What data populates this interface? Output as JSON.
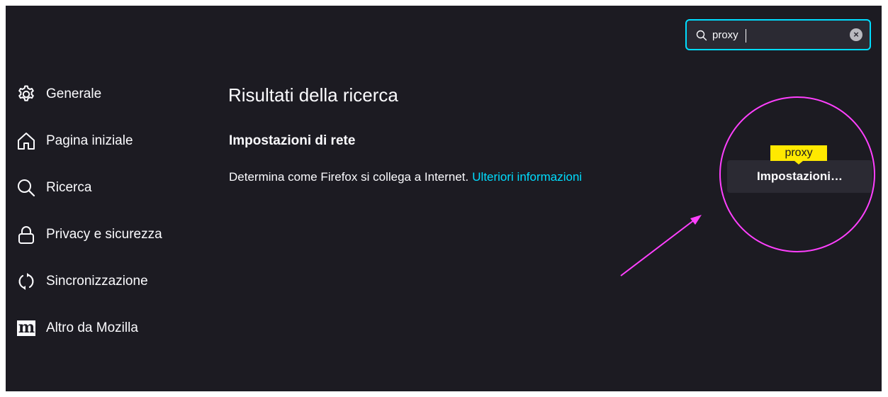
{
  "search": {
    "value": "proxy",
    "icon": "search-icon",
    "clear_icon": "close-icon"
  },
  "sidebar": {
    "items": [
      {
        "label": "Generale",
        "icon": "gear-icon"
      },
      {
        "label": "Pagina iniziale",
        "icon": "home-icon"
      },
      {
        "label": "Ricerca",
        "icon": "search-icon"
      },
      {
        "label": "Privacy e sicurezza",
        "icon": "lock-icon"
      },
      {
        "label": "Sincronizzazione",
        "icon": "sync-icon"
      },
      {
        "label": "Altro da Mozilla",
        "icon": "mozilla-icon",
        "icon_text": "m"
      }
    ]
  },
  "main": {
    "title": "Risultati della ricerca",
    "section_title": "Impostazioni di rete",
    "description": "Determina come Firefox si collega a Internet.",
    "learn_more": "Ulteriori informazioni",
    "settings_button": "Impostazioni…",
    "search_tooltip": "proxy"
  },
  "colors": {
    "background": "#1c1b22",
    "accent": "#00ddff",
    "tooltip": "#ffe900",
    "annotation": "#ff40ff"
  }
}
